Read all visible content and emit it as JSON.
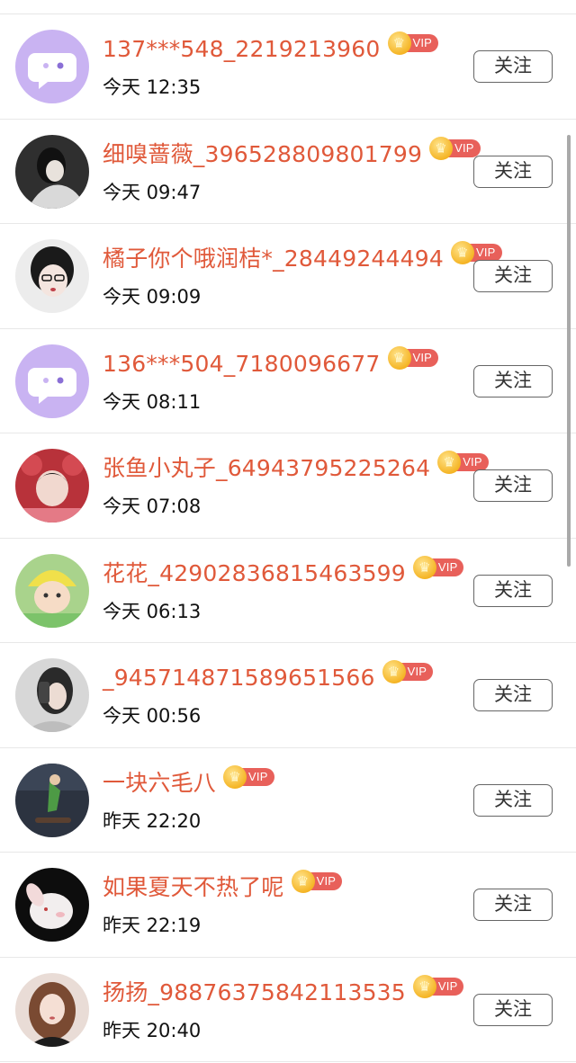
{
  "follow_label": "关注",
  "vip_label": "VIP",
  "colors": {
    "name": "#e0593a",
    "vip_pill": "#e8605a",
    "crown": "#f5b526"
  },
  "users": [
    {
      "name": "137***548_2219213960",
      "time": "今天 12:35",
      "avatar": "default-chat-icon"
    },
    {
      "name": "细嗅蔷薇_396528809801799",
      "time": "今天 09:47",
      "avatar": "photo"
    },
    {
      "name": "橘子你个哦润桔*_28449244494",
      "time": "今天 09:09",
      "avatar": "photo"
    },
    {
      "name": "136***504_7180096677",
      "time": "今天 08:11",
      "avatar": "default-chat-icon"
    },
    {
      "name": "张鱼小丸子_64943795225264",
      "time": "今天 07:08",
      "avatar": "photo"
    },
    {
      "name": "花花_42902836815463599",
      "time": "今天 06:13",
      "avatar": "photo"
    },
    {
      "name": "_945714871589651566",
      "time": "今天 00:56",
      "avatar": "photo"
    },
    {
      "name": "一块六毛八",
      "time": "昨天 22:20",
      "avatar": "photo"
    },
    {
      "name": "如果夏天不热了呢",
      "time": "昨天 22:19",
      "avatar": "photo"
    },
    {
      "name": "扬扬_98876375842113535",
      "time": "昨天 20:40",
      "avatar": "photo"
    }
  ]
}
